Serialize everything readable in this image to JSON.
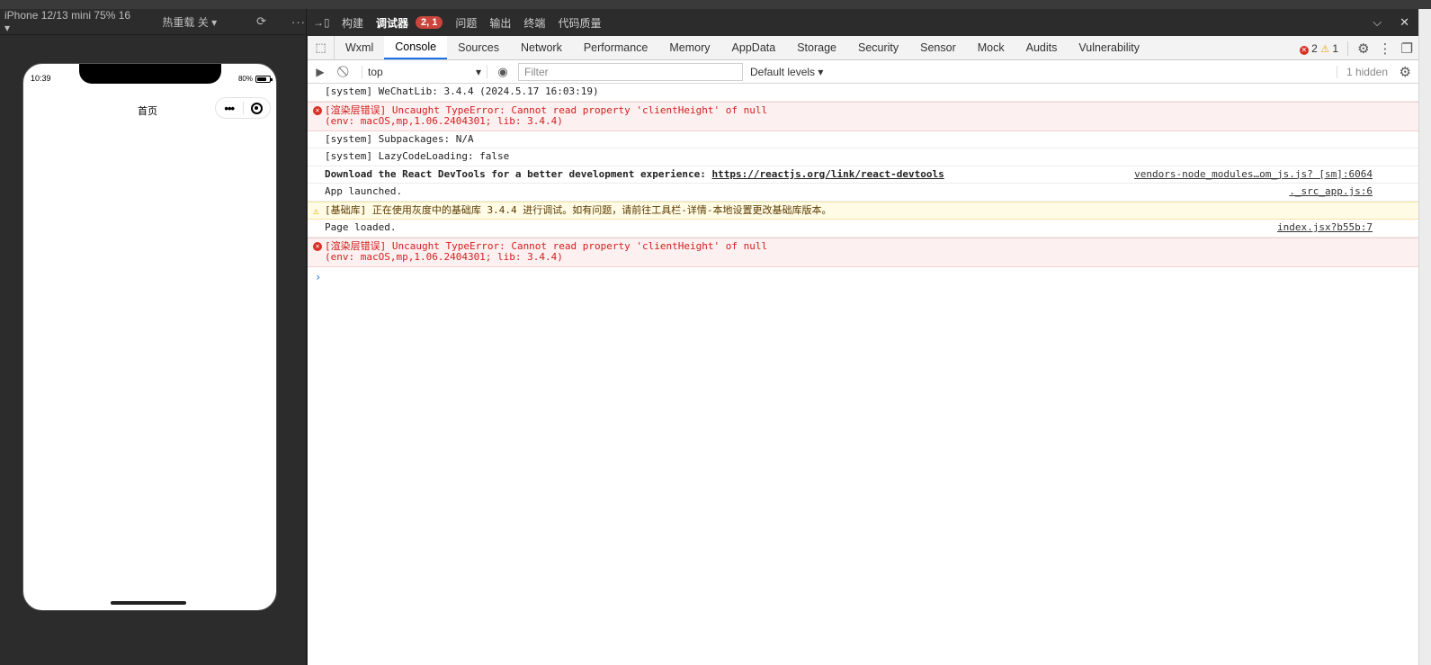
{
  "simulator": {
    "device": "iPhone 12/13 mini 75% 16 ▾",
    "hot_reload": "热重载 关 ▾",
    "status_time": "10:39",
    "battery": "80%",
    "page_title": "首页"
  },
  "ide_tabs": {
    "items": [
      "构建",
      "调试器",
      "问题",
      "输出",
      "终端",
      "代码质量"
    ],
    "badge": "2, 1"
  },
  "devtools_tabs": [
    "Wxml",
    "Console",
    "Sources",
    "Network",
    "Performance",
    "Memory",
    "AppData",
    "Storage",
    "Security",
    "Sensor",
    "Mock",
    "Audits",
    "Vulnerability"
  ],
  "counts": {
    "errors": "2",
    "warnings": "1"
  },
  "console_toolbar": {
    "context": "top",
    "filter_placeholder": "Filter",
    "levels": "Default levels ▾",
    "hidden": "1 hidden"
  },
  "log": [
    {
      "type": "info",
      "l1": "[system] WeChatLib: 3.4.4 (2024.5.17 16:03:19)",
      "l2": "",
      "src": ""
    },
    {
      "type": "error",
      "l1": "[渲染层错误] Uncaught TypeError: Cannot read property 'clientHeight' of null",
      "l2": "(env: macOS,mp,1.06.2404301; lib: 3.4.4)",
      "src": ""
    },
    {
      "type": "info",
      "l1": "[system] Subpackages: N/A",
      "l2": "",
      "src": ""
    },
    {
      "type": "info",
      "l1": "[system] LazyCodeLoading: false",
      "l2": "",
      "src": ""
    },
    {
      "type": "bold",
      "l1": "Download the React DevTools for a better development experience: ",
      "link": "https://reactjs.org/link/react-devtools",
      "l2": "",
      "src": "vendors-node_modules…om_js.js? [sm]:6064"
    },
    {
      "type": "info",
      "l1": "App launched.",
      "l2": "",
      "src": "._src_app.js:6"
    },
    {
      "type": "warn",
      "l1": "[基础库] 正在使用灰度中的基础库 3.4.4 进行调试。如有问题，请前往工具栏-详情-本地设置更改基础库版本。",
      "l2": "",
      "src": ""
    },
    {
      "type": "info",
      "l1": "Page loaded.",
      "l2": "",
      "src": "index.jsx?b55b:7"
    },
    {
      "type": "error",
      "l1": "[渲染层错误] Uncaught TypeError: Cannot read property 'clientHeight' of null",
      "l2": "(env: macOS,mp,1.06.2404301; lib: 3.4.4)",
      "src": ""
    }
  ],
  "prompt_glyph": "›"
}
